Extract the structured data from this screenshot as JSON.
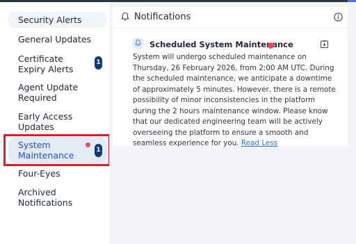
{
  "sidebar": {
    "items": [
      {
        "label": "Security Alerts"
      },
      {
        "label": "General Updates"
      },
      {
        "label": "Certificate Expiry Alerts",
        "badge": "1"
      },
      {
        "label": "Agent Update Required"
      },
      {
        "label": "Early Access Updates"
      },
      {
        "label": "System Maintenance",
        "badge": "1",
        "unread_dot": true,
        "active": true
      },
      {
        "label": "Four-Eyes"
      },
      {
        "label": "Archived Notifications"
      }
    ]
  },
  "panel": {
    "title": "Notifications",
    "header_icon": "bell-icon",
    "info_icon": "info-icon"
  },
  "notification": {
    "title": "Scheduled System Maintenance",
    "icon": "bell-icon",
    "action_icon": "archive-icon",
    "body": "System will undergo scheduled maintenance on Thursday, 26 February 2026, from 2:00 AM UTC. During the scheduled maintenance, we anticipate a downtime of approximately 5 minutes. However, there is a remote possibility of minor inconsistencies in the platform during the 2 hours maintenance window. Please know that our dedicated engineering team will be actively overseeing the platform to ensure a smooth and seamless experience for you.",
    "toggle_label": "Read Less"
  },
  "colors": {
    "accent": "#1d4ed8",
    "badge": "#123a7a",
    "unread_dot": "#ea4b5f",
    "highlight": "#e21b22",
    "link": "#2f6fd6"
  }
}
